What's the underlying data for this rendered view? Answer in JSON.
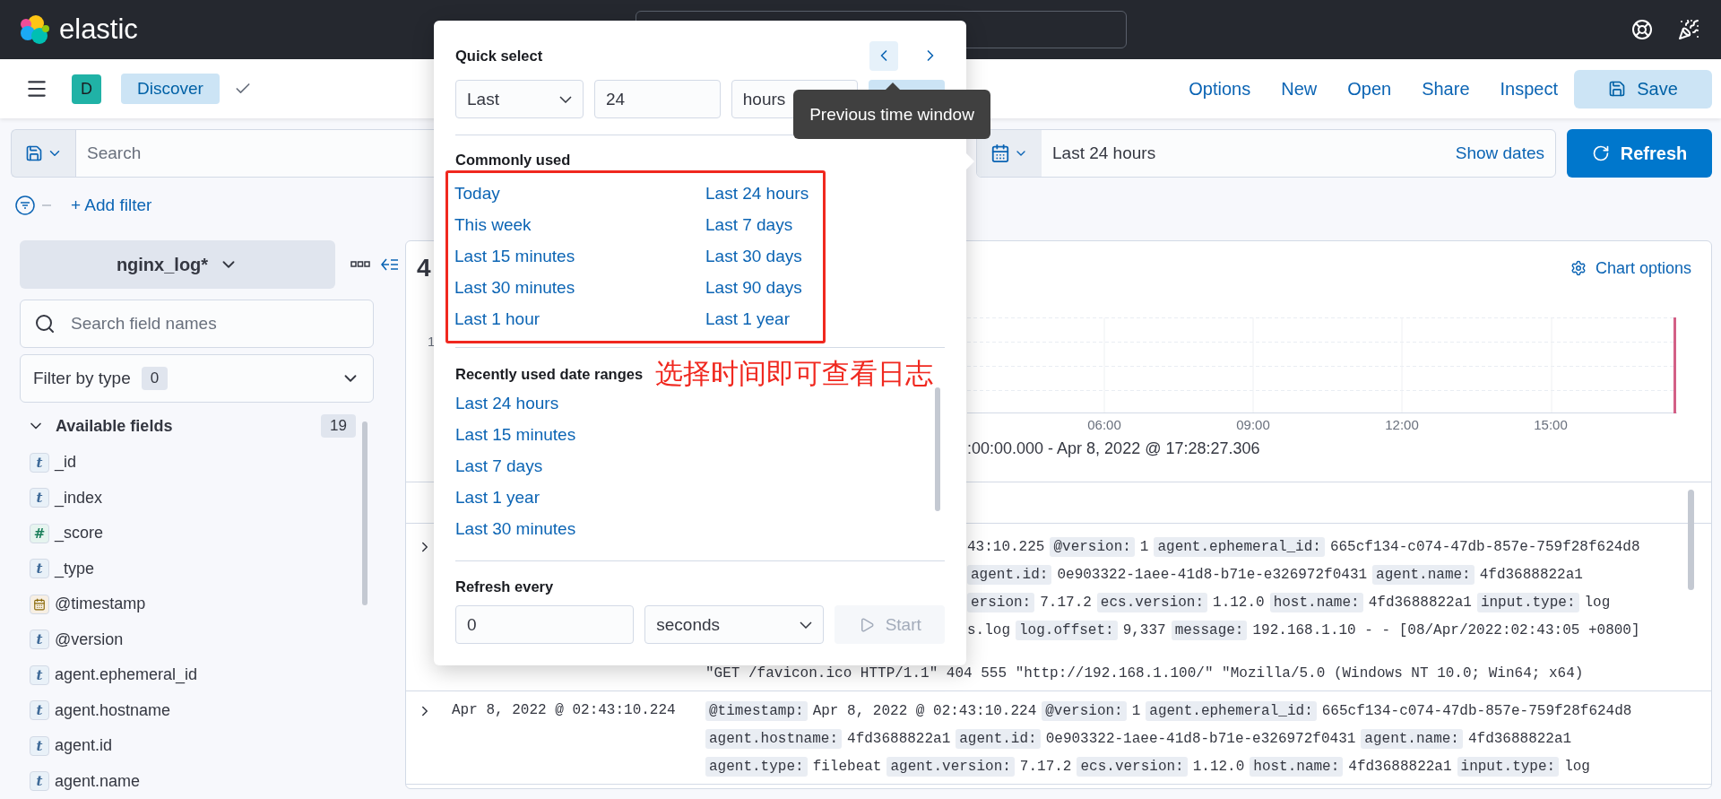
{
  "header": {
    "logo_text": "elastic"
  },
  "app_bar": {
    "avatar": "D",
    "app": "Discover",
    "actions": [
      "Options",
      "New",
      "Open",
      "Share",
      "Inspect"
    ],
    "save": "Save"
  },
  "query_bar": {
    "placeholder": "Search",
    "date_range": "Last 24 hours",
    "show_dates": "Show dates",
    "refresh": "Refresh"
  },
  "filter_bar": {
    "add_filter": "+ Add filter"
  },
  "sidebar": {
    "index_pattern": "nginx_log*",
    "search_placeholder": "Search field names",
    "filter_label": "Filter by type",
    "filter_count": "0",
    "section": {
      "title": "Available fields",
      "count": "19",
      "expanded": true
    },
    "fields": [
      {
        "name": "_id",
        "kind": "string",
        "glyph": "t"
      },
      {
        "name": "_index",
        "kind": "string",
        "glyph": "t"
      },
      {
        "name": "_score",
        "kind": "number",
        "glyph": "#"
      },
      {
        "name": "_type",
        "kind": "string",
        "glyph": "t"
      },
      {
        "name": "@timestamp",
        "kind": "date"
      },
      {
        "name": "@version",
        "kind": "string",
        "glyph": "t"
      },
      {
        "name": "agent.ephemeral_id",
        "kind": "string",
        "glyph": "t"
      },
      {
        "name": "agent.hostname",
        "kind": "string",
        "glyph": "t"
      },
      {
        "name": "agent.id",
        "kind": "string",
        "glyph": "t"
      },
      {
        "name": "agent.name",
        "kind": "string",
        "glyph": "t"
      }
    ]
  },
  "histogram": {
    "hits": "4",
    "chart_options": "Chart options",
    "y_ticks": [
      "1"
    ],
    "x_ticks": [
      "06:00",
      "09:00",
      "12:00",
      "15:00"
    ],
    "time_range": ":00:00.000 - Apr 8, 2022 @ 17:28:27.306"
  },
  "documents": [
    {
      "expanded": false,
      "lines_beside_popover": [
        [
          {
            "kind": "value",
            "text": "43:10.225"
          },
          {
            "kind": "key",
            "text": "@version:"
          },
          {
            "kind": "value",
            "text": "1"
          },
          {
            "kind": "key",
            "text": "agent.ephemeral_id:"
          },
          {
            "kind": "value",
            "text": "665cf134-c074-47db-857e-759f28f624d8"
          }
        ],
        [
          {
            "kind": "key",
            "text": "agent.id:"
          },
          {
            "kind": "value",
            "text": "0e903322-1aee-41d8-b71e-e326972f0431"
          },
          {
            "kind": "key",
            "text": "agent.name:"
          },
          {
            "kind": "value",
            "text": "4fd3688822a1"
          }
        ],
        [
          {
            "kind": "key",
            "text": "ersion:"
          },
          {
            "kind": "value",
            "text": "7.17.2"
          },
          {
            "kind": "key",
            "text": "ecs.version:"
          },
          {
            "kind": "value",
            "text": "1.12.0"
          },
          {
            "kind": "key",
            "text": "host.name:"
          },
          {
            "kind": "value",
            "text": "4fd3688822a1"
          },
          {
            "kind": "key",
            "text": "input.type:"
          },
          {
            "kind": "value",
            "text": "log"
          }
        ],
        [
          {
            "kind": "value",
            "text": "s.log"
          },
          {
            "kind": "key",
            "text": "log.offset:"
          },
          {
            "kind": "value",
            "text": "9,337"
          },
          {
            "kind": "key",
            "text": "message:"
          },
          {
            "kind": "value",
            "text": "192.168.1.10 - - [08/Apr/2022:02:43:05 +0800]"
          }
        ]
      ],
      "lines": [
        [
          {
            "kind": "value",
            "text": "\"GET /favicon.ico HTTP/1.1\" 404 555 \"http://192.168.1.100/\" \"Mozilla/5.0 (Windows NT 10.0; Win64; x64)"
          }
        ]
      ]
    },
    {
      "expanded": false,
      "timestamp": "Apr 8, 2022 @ 02:43:10.224",
      "lines": [
        [
          {
            "kind": "key",
            "text": "@timestamp:"
          },
          {
            "kind": "value",
            "text": "Apr 8, 2022 @ 02:43:10.224"
          },
          {
            "kind": "key",
            "text": "@version:"
          },
          {
            "kind": "value",
            "text": "1"
          },
          {
            "kind": "key",
            "text": "agent.ephemeral_id:"
          },
          {
            "kind": "value",
            "text": "665cf134-c074-47db-857e-759f28f624d8"
          }
        ],
        [
          {
            "kind": "key",
            "text": "agent.hostname:"
          },
          {
            "kind": "value",
            "text": "4fd3688822a1"
          },
          {
            "kind": "key",
            "text": "agent.id:"
          },
          {
            "kind": "value",
            "text": "0e903322-1aee-41d8-b71e-e326972f0431"
          },
          {
            "kind": "key",
            "text": "agent.name:"
          },
          {
            "kind": "value",
            "text": "4fd3688822a1"
          }
        ],
        [
          {
            "kind": "key",
            "text": "agent.type:"
          },
          {
            "kind": "value",
            "text": "filebeat"
          },
          {
            "kind": "key",
            "text": "agent.version:"
          },
          {
            "kind": "value",
            "text": "7.17.2"
          },
          {
            "kind": "key",
            "text": "ecs.version:"
          },
          {
            "kind": "value",
            "text": "1.12.0"
          },
          {
            "kind": "key",
            "text": "host.name:"
          },
          {
            "kind": "value",
            "text": "4fd3688822a1"
          },
          {
            "kind": "key",
            "text": "input.type:"
          },
          {
            "kind": "value",
            "text": "log"
          }
        ]
      ]
    }
  ],
  "popover": {
    "quick_select": {
      "title": "Quick select",
      "tense": "Last",
      "value": "24",
      "unit": "hours",
      "tooltip": "Previous time window"
    },
    "commonly_used": {
      "title": "Commonly used",
      "columns": [
        [
          "Today",
          "This week",
          "Last 15 minutes",
          "Last 30 minutes",
          "Last 1 hour"
        ],
        [
          "Last 24 hours",
          "Last 7 days",
          "Last 30 days",
          "Last 90 days",
          "Last 1 year"
        ]
      ]
    },
    "annotation": "选择时间即可查看日志",
    "recently_used": {
      "title": "Recently used date ranges",
      "items": [
        "Last 24 hours",
        "Last 15 minutes",
        "Last 7 days",
        "Last 1 year",
        "Last 30 minutes"
      ]
    },
    "refresh": {
      "title": "Refresh every",
      "value": "0",
      "unit": "seconds",
      "start": "Start",
      "disabled": true
    }
  }
}
